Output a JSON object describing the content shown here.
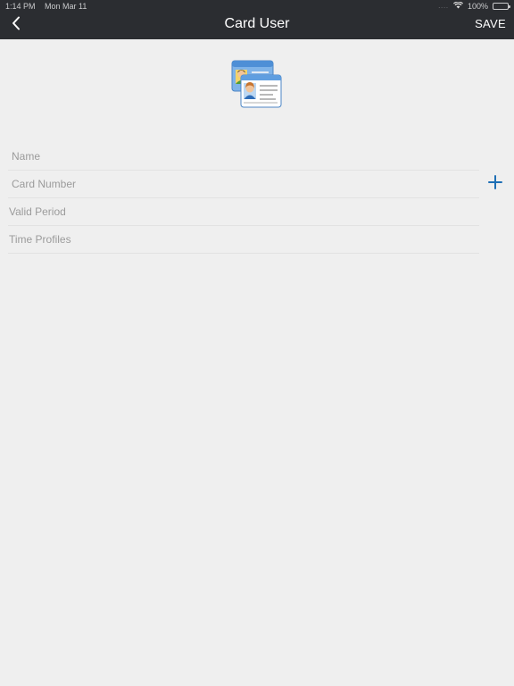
{
  "status_bar": {
    "time": "1:14 PM",
    "date": "Mon Mar 11",
    "signal": "....",
    "battery_percent": "100%",
    "battery_level": 1.0,
    "icons": [
      "wifi-icon",
      "battery-icon"
    ]
  },
  "nav": {
    "title": "Card User",
    "save_label": "SAVE",
    "back_icon": "chevron-left-icon"
  },
  "avatar": {
    "icon": "card-user-icon"
  },
  "form": {
    "name_placeholder": "Name",
    "card_number_placeholder": "Card Number",
    "valid_period_label": "Valid Period",
    "time_profiles_label": "Time Profiles",
    "add_icon": "plus-icon"
  },
  "colors": {
    "nav_background": "#2b2d31",
    "page_background": "#efefef",
    "accent": "#1e6fb5",
    "label_text": "#9b9b9b"
  }
}
